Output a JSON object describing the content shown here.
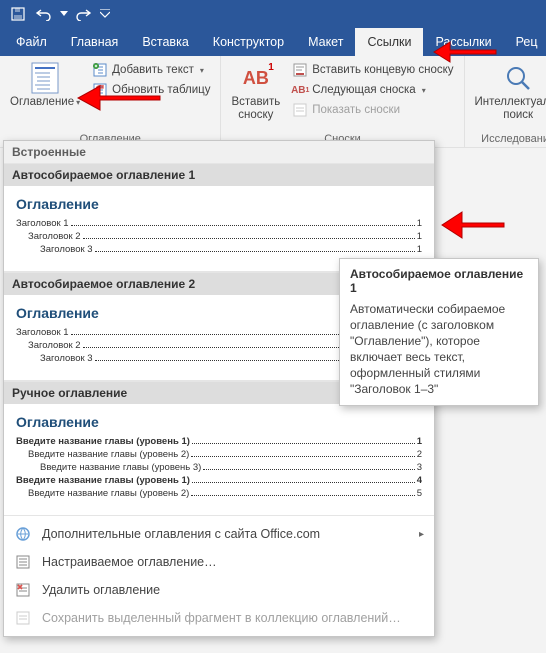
{
  "qat": {
    "save": "save-icon",
    "undo": "undo-icon",
    "redo": "redo-icon"
  },
  "tabs": {
    "file": "Файл",
    "home": "Главная",
    "insert": "Вставка",
    "design": "Конструктор",
    "layout": "Макет",
    "references": "Ссылки",
    "mailings": "Рассылки",
    "review": "Рец"
  },
  "activeTab": "references",
  "ribbon": {
    "toc_group": {
      "label": "Оглавление",
      "toc_button": "Оглавление",
      "add_text": "Добавить текст",
      "update_table": "Обновить таблицу"
    },
    "footnotes_group": {
      "label": "Сноски",
      "insert_btn_line1": "Вставить",
      "insert_btn_line2": "сноску",
      "ab_badge": "AB",
      "ab_sup": "1",
      "insert_endnote": "Вставить концевую сноску",
      "next_footnote": "Следующая сноска",
      "show_notes": "Показать сноски"
    },
    "research_group": {
      "label": "Исследование",
      "smart_line1": "Интеллектуальн",
      "smart_line2": "поиск"
    }
  },
  "gallery": {
    "builtin_header": "Встроенные",
    "auto1_title": "Автособираемое оглавление 1",
    "auto2_title": "Автособираемое оглавление 2",
    "manual_title": "Ручное оглавление",
    "preview_heading": "Оглавление",
    "auto_entries": [
      {
        "label": "Заголовок 1",
        "page": "1",
        "level": 1
      },
      {
        "label": "Заголовок 2",
        "page": "1",
        "level": 2
      },
      {
        "label": "Заголовок 3",
        "page": "1",
        "level": 3
      }
    ],
    "manual_entries": [
      {
        "label": "Введите название главы (уровень 1)",
        "page": "1",
        "level": 1,
        "bold": true
      },
      {
        "label": "Введите название главы (уровень 2)",
        "page": "2",
        "level": 2
      },
      {
        "label": "Введите название главы (уровень 3)",
        "page": "3",
        "level": 3
      },
      {
        "label": "Введите название главы (уровень 1)",
        "page": "4",
        "level": 1,
        "bold": true
      },
      {
        "label": "Введите название главы (уровень 2)",
        "page": "5",
        "level": 2
      }
    ],
    "menu": {
      "more_office": "Дополнительные оглавления с сайта Office.com",
      "custom": "Настраиваемое оглавление…",
      "remove": "Удалить оглавление",
      "save_selection": "Сохранить выделенный фрагмент в коллекцию оглавлений…"
    }
  },
  "tooltip": {
    "title": "Автособираемое оглавление 1",
    "body": "Автоматически собираемое оглавление (с заголовком \"Оглавление\"), которое включает весь текст, оформленный стилями \"Заголовок 1–3\""
  }
}
